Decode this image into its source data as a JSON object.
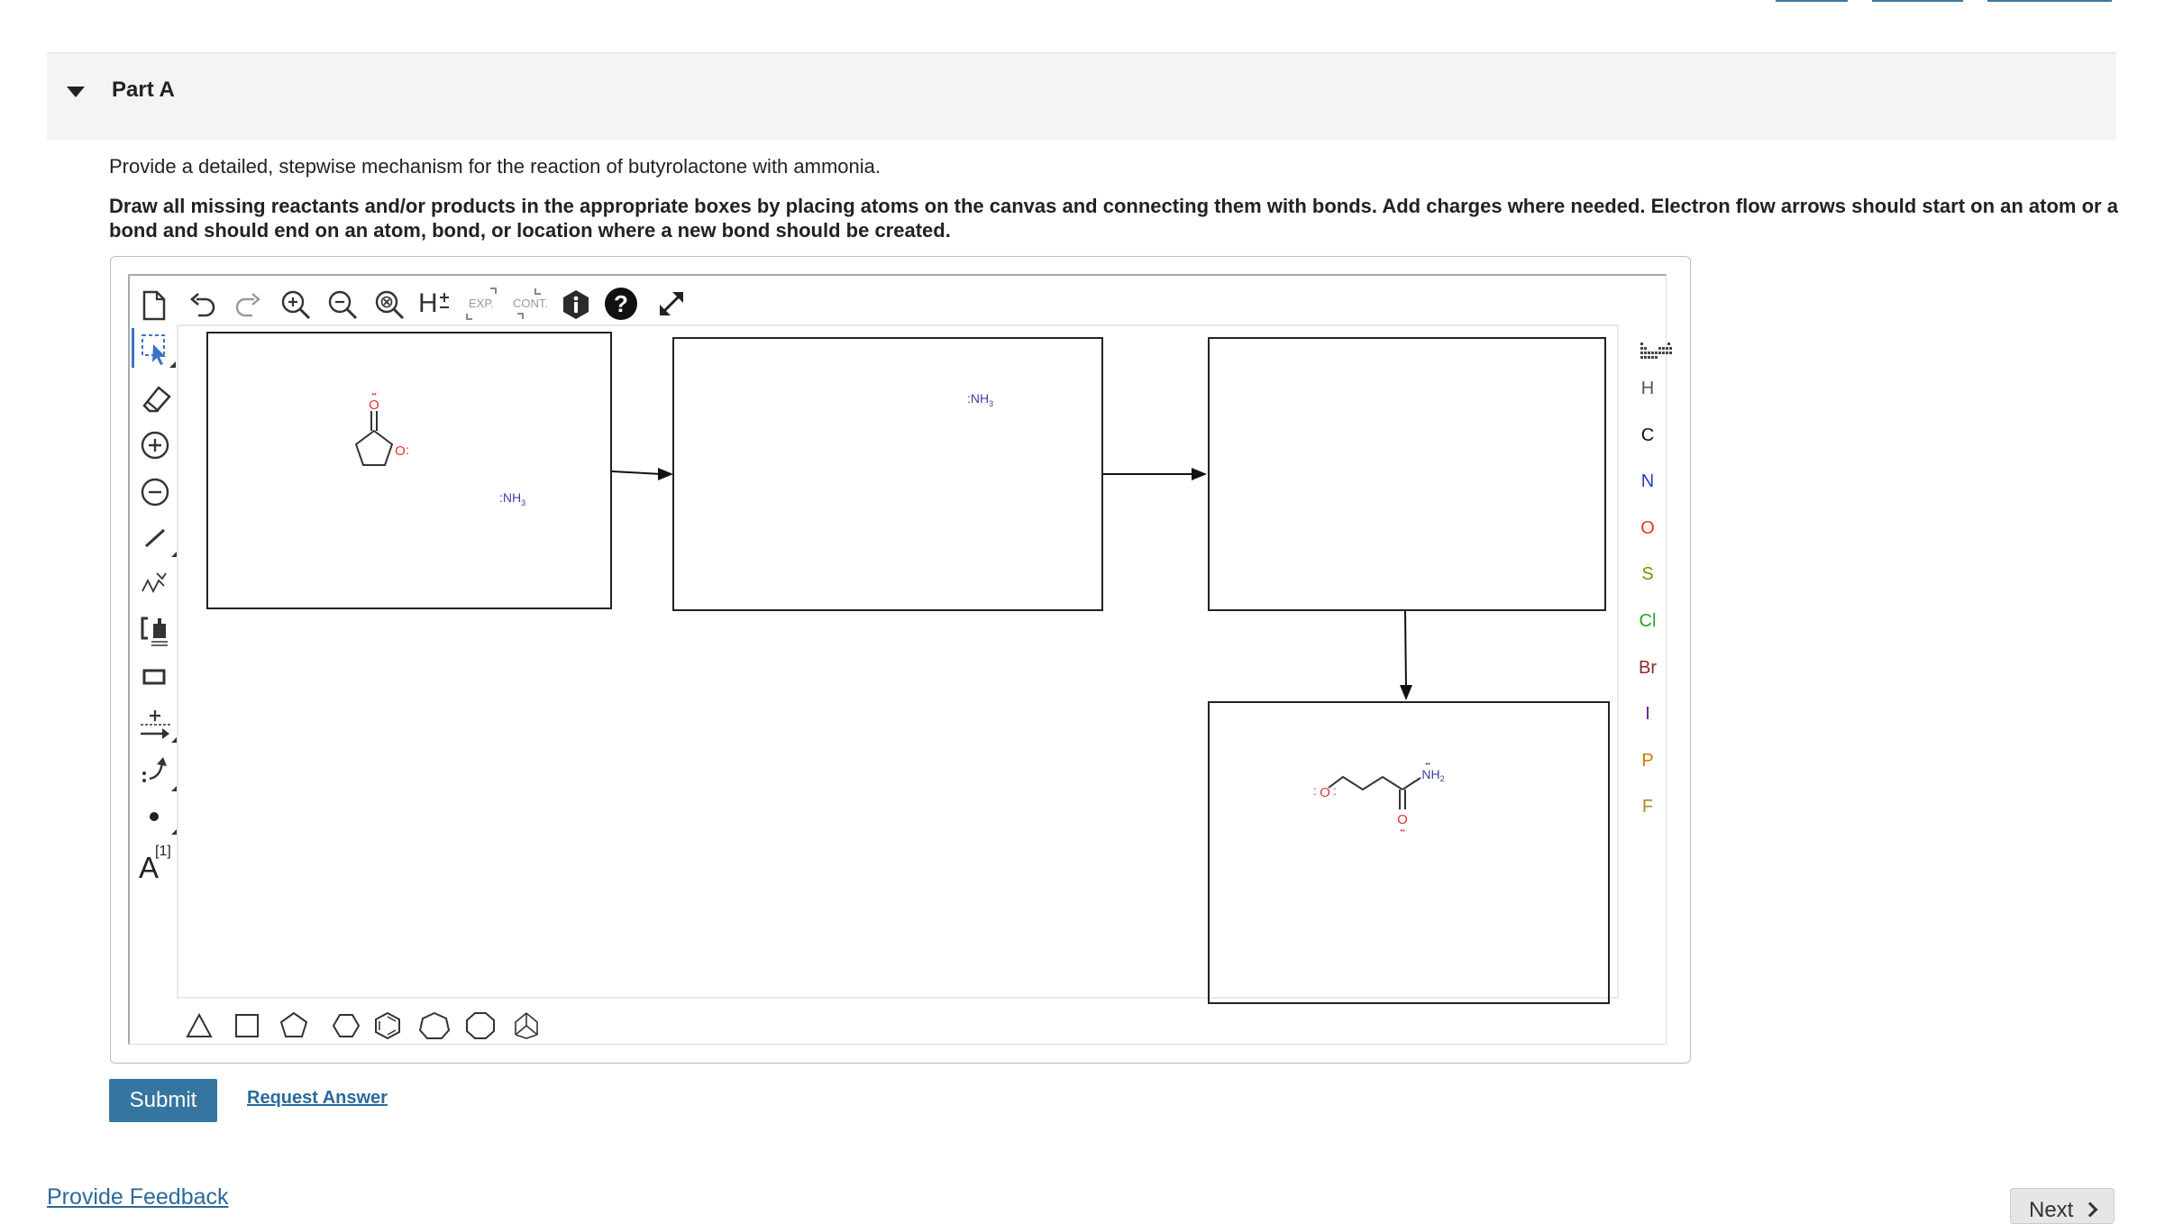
{
  "part": {
    "title": "Part A"
  },
  "question": {
    "prompt": "Provide a detailed, stepwise mechanism for the reaction of butyrolactone with ammonia.",
    "instructions": "Draw all missing reactants and/or products in the appropriate boxes by placing atoms on the canvas and connecting them with bonds. Add charges where needed. Electron flow arrows should start on an atom or a bond and should end on an atom, bond, or location where a new bond should be created."
  },
  "toolbar": {
    "top_tools": [
      "new-document-icon",
      "undo-icon",
      "redo-icon",
      "zoom-in-icon",
      "zoom-out-icon",
      "zoom-reset-icon",
      "hydrogen-toggle-icon",
      "expand-icon",
      "contract-icon",
      "info-icon",
      "help-icon",
      "fullscreen-icon"
    ],
    "h_label": "H",
    "exp_label": "EXP.",
    "cont_label": "CONT.",
    "left_tools": [
      "select-icon",
      "eraser-icon",
      "positive-charge-icon",
      "negative-charge-icon",
      "single-bond-icon",
      "chain-icon",
      "bracket-icon",
      "rectangle-icon",
      "reaction-arrow-icon",
      "electron-flow-arrow-icon",
      "radical-dot-icon",
      "text-icon"
    ],
    "text_tool_label": "A",
    "text_tool_sup": "[1]"
  },
  "elements": [
    {
      "symbol": "H",
      "color": "#555555"
    },
    {
      "symbol": "C",
      "color": "#111111"
    },
    {
      "symbol": "N",
      "color": "#2a3fb0"
    },
    {
      "symbol": "O",
      "color": "#e8312e"
    },
    {
      "symbol": "S",
      "color": "#8a8a00"
    },
    {
      "symbol": "Cl",
      "color": "#2aa02a"
    },
    {
      "symbol": "Br",
      "color": "#8a2a2a"
    },
    {
      "symbol": "I",
      "color": "#6a1a9a"
    },
    {
      "symbol": "P",
      "color": "#cc7a00"
    },
    {
      "symbol": "F",
      "color": "#b08a20"
    }
  ],
  "shapes": [
    "triangle",
    "square",
    "pentagon",
    "hexagon",
    "benzene",
    "heptagon",
    "octagon",
    "bicyclic"
  ],
  "canvas": {
    "nh3_label": "NH",
    "nh3_sub": "3",
    "nh2_label": "NH",
    "nh2_sub": "2",
    "o_label": "O",
    "lone_pair": ":",
    "lone_pair_dots": "••",
    "nitrogen_color": "#3b3fa8",
    "oxygen_color": "#e8312e"
  },
  "actions": {
    "submit_label": "Submit",
    "request_answer_label": "Request Answer",
    "feedback_label": "Provide Feedback",
    "next_label": "Next",
    "next_icon": "chevron-right-icon"
  }
}
